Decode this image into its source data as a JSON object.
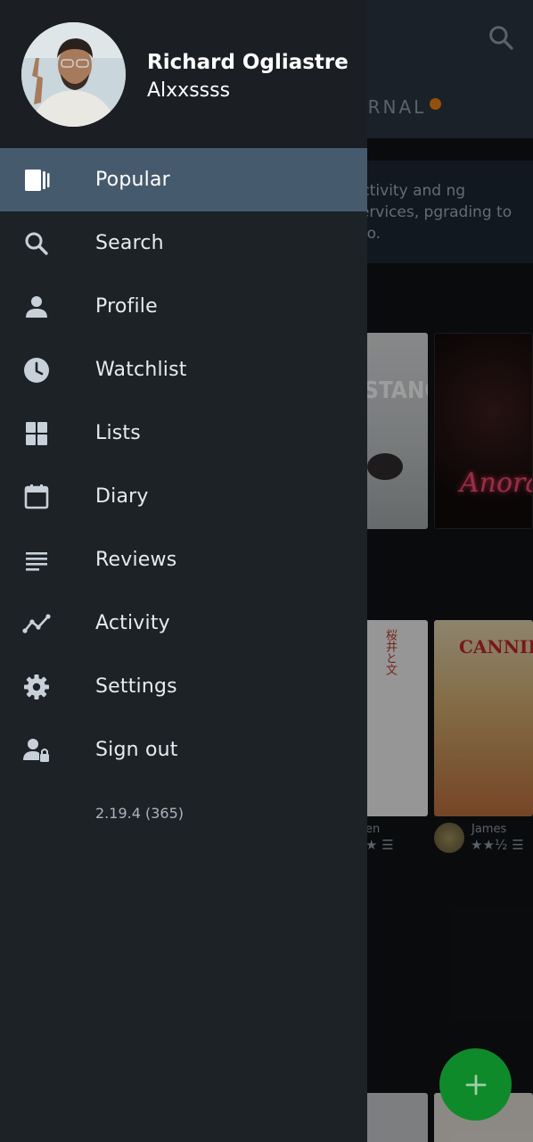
{
  "background": {
    "tab_journal": "URNAL",
    "banner_text": "activity and ng services, pgrading to Pro.",
    "posters": {
      "poster1_title": "STANCE",
      "poster2_title": "Anora",
      "poster3_title": "桜井と文",
      "poster4_title": "CANNIBAL"
    },
    "reviews": [
      {
        "name": "en",
        "stars": "★ ☰"
      },
      {
        "name": "James",
        "stars": "★★½ ☰"
      }
    ],
    "fab_icon": "plus-icon",
    "fab_color": "#0f8a2b"
  },
  "drawer": {
    "user": {
      "name": "Richard Ogliastre",
      "handle": "Alxxssss"
    },
    "items": [
      {
        "label": "Popular",
        "icon": "popular-icon",
        "active": true
      },
      {
        "label": "Search",
        "icon": "search-icon",
        "active": false
      },
      {
        "label": "Profile",
        "icon": "person-icon",
        "active": false
      },
      {
        "label": "Watchlist",
        "icon": "clock-icon",
        "active": false
      },
      {
        "label": "Lists",
        "icon": "grid-icon",
        "active": false
      },
      {
        "label": "Diary",
        "icon": "calendar-icon",
        "active": false
      },
      {
        "label": "Reviews",
        "icon": "lines-icon",
        "active": false
      },
      {
        "label": "Activity",
        "icon": "activity-icon",
        "active": false
      },
      {
        "label": "Settings",
        "icon": "gear-icon",
        "active": false
      },
      {
        "label": "Sign out",
        "icon": "person-lock-icon",
        "active": false
      }
    ],
    "version": "2.19.4 (365)"
  },
  "colors": {
    "drawer_bg": "#1d2227",
    "active_bg": "#455a6d",
    "icon": "#c8d1d9",
    "notification_dot": "#e27d12"
  }
}
